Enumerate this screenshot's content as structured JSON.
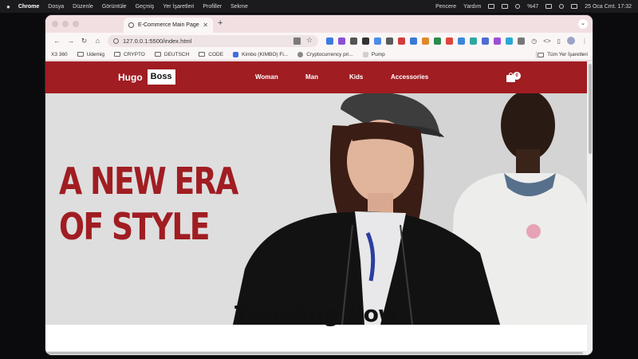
{
  "menubar": {
    "app": "Chrome",
    "items": [
      "Dosya",
      "Düzenle",
      "Görüntüle",
      "Geçmiş",
      "Yer İşaretleri",
      "Profiller",
      "Sekme"
    ],
    "right_items": [
      "Pencere",
      "Yardım"
    ],
    "battery": "%47",
    "datetime": "25 Oca Cmt. 17:32"
  },
  "browser": {
    "tab_title": "E-Commerce Main Page",
    "url": "127.0.0.1:5500/index.html",
    "bookmarks": [
      {
        "label": "X3 360",
        "kind": "text"
      },
      {
        "label": "Udemig",
        "kind": "folder"
      },
      {
        "label": "CRYPTO",
        "kind": "folder"
      },
      {
        "label": "DEUTSCH",
        "kind": "folder"
      },
      {
        "label": "CODE",
        "kind": "folder"
      },
      {
        "label": "Kimbo (KIMBO) Fi...",
        "kind": "site"
      },
      {
        "label": "Cryptocurrency pri...",
        "kind": "site"
      },
      {
        "label": "Pump",
        "kind": "site"
      }
    ],
    "all_bookmarks": "Tüm Yer İşaretleri"
  },
  "site": {
    "logo_word": "Hugo",
    "logo_box": "Boss",
    "nav": [
      "Woman",
      "Man",
      "Kids",
      "Accessories"
    ],
    "cart_count": "0",
    "hero_line1": "A NEW ERA",
    "hero_line2": "OF STYLE",
    "section_title": "Trending Now"
  },
  "colors": {
    "brand_red": "#a01d22",
    "hero_bg": "#dcdcdc"
  }
}
